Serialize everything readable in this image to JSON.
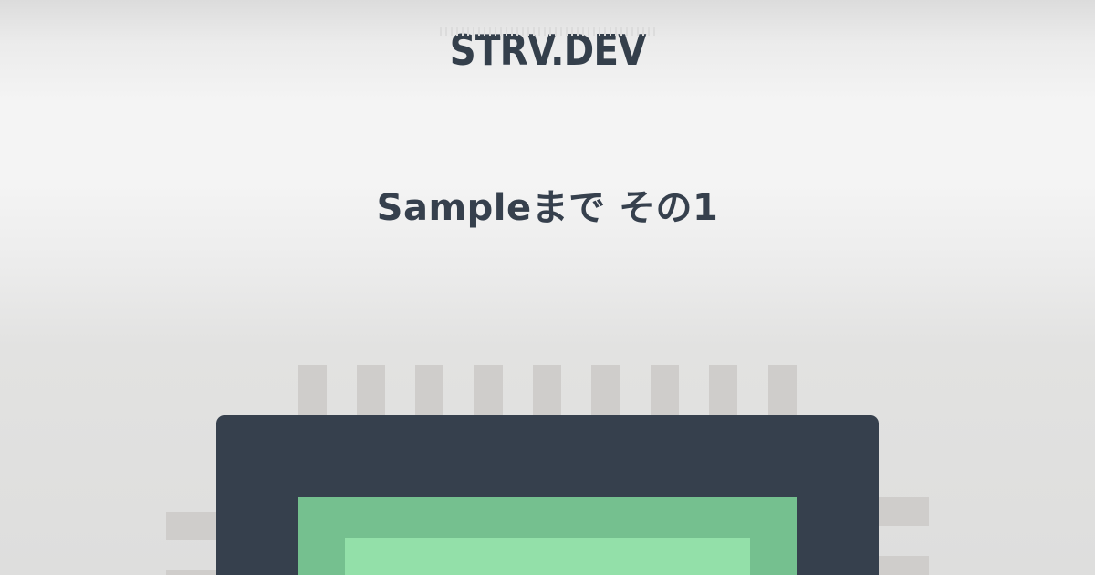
{
  "brand": {
    "logo_text": "STRV.DEV"
  },
  "article": {
    "title": "Sampleまで その1"
  },
  "illustration": {
    "icon": "cpu-chip-icon",
    "colors": {
      "chip_body": "#36404d",
      "chip_outer_die": "#75c08f",
      "chip_inner_die": "#93e0a9",
      "pins": "#cfcdcb",
      "text": "#36404d"
    }
  }
}
